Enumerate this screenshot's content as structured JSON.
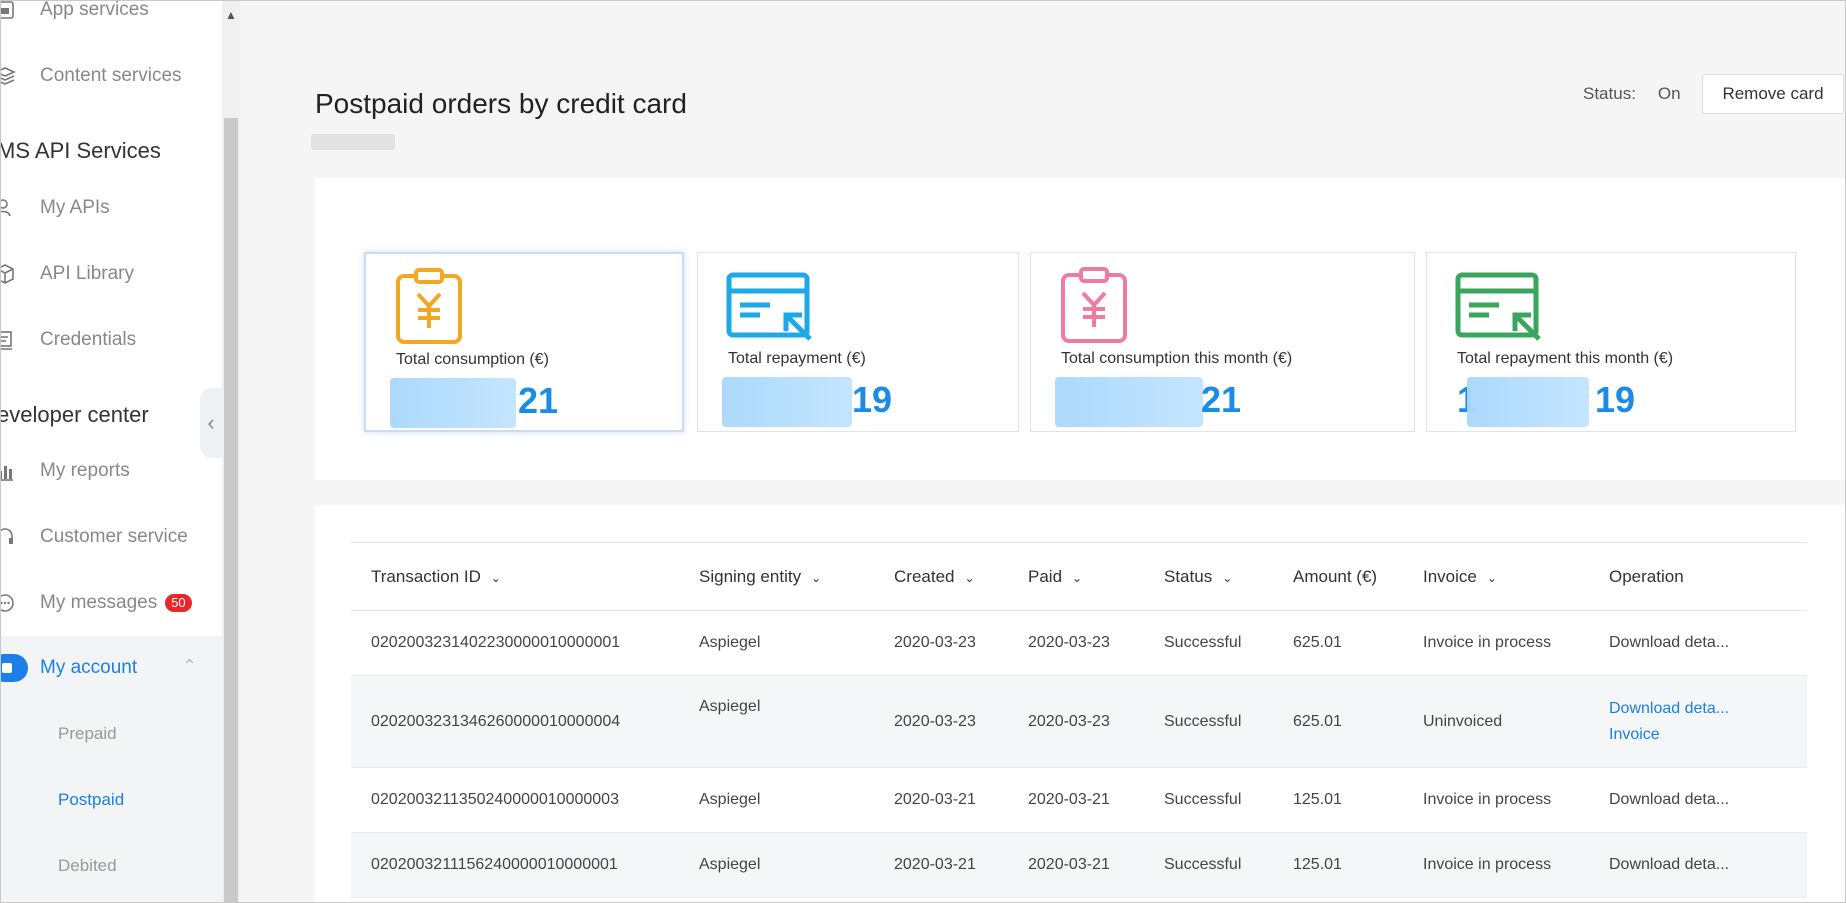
{
  "sidebar": {
    "items": [
      {
        "label": "App services",
        "icon": "app-icon"
      },
      {
        "label": "Content services",
        "icon": "layers-icon"
      }
    ],
    "section_api": "MS API Services",
    "api_items": [
      {
        "label": "My APIs",
        "icon": "user-api-icon"
      },
      {
        "label": "API Library",
        "icon": "cube-icon"
      },
      {
        "label": "Credentials",
        "icon": "credentials-icon"
      }
    ],
    "section_dev": "eveloper center",
    "dev_items": [
      {
        "label": "My reports",
        "icon": "bar-chart-icon"
      },
      {
        "label": "Customer service",
        "icon": "headset-icon"
      },
      {
        "label": "My messages",
        "icon": "chat-icon",
        "badge": "50"
      }
    ],
    "account": {
      "label": "My account",
      "icon": "wallet-icon"
    },
    "account_sub": [
      {
        "label": "Prepaid"
      },
      {
        "label": "Postpaid"
      },
      {
        "label": "Debited"
      }
    ]
  },
  "header": {
    "title": "Postpaid orders by credit card",
    "status_label": "Status:",
    "status_value": "On",
    "remove_button": "Remove card"
  },
  "cards": [
    {
      "label": "Total consumption (€)",
      "value_suffix": "21",
      "icon": "clipboard-yen-icon",
      "color": "#f5a623"
    },
    {
      "label": "Total repayment (€)",
      "value_suffix": "19",
      "icon": "card-return-icon",
      "color": "#1da9e6"
    },
    {
      "label": "Total consumption this month (€)",
      "value_suffix": "21",
      "icon": "clipboard-yen-icon",
      "color": "#f07aa0"
    },
    {
      "label": "Total repayment this month (€)",
      "value_prefix": "1",
      "value_suffix": "19",
      "icon": "card-return-icon",
      "color": "#3aa55c"
    }
  ],
  "table": {
    "headers": [
      "Transaction ID",
      "Signing entity",
      "Created",
      "Paid",
      "Status",
      "Amount (€)",
      "Invoice",
      "Operation"
    ],
    "rows": [
      {
        "id": "0202003231402230000010000001",
        "entity": "Aspiegel",
        "created": "2020-03-23",
        "paid": "2020-03-23",
        "status": "Successful",
        "amount": "625.01",
        "invoice": "Invoice in process",
        "op1": "Download deta...",
        "op2": ""
      },
      {
        "id": "0202003231346260000010000004",
        "entity": "Aspiegel",
        "created": "2020-03-23",
        "paid": "2020-03-23",
        "status": "Successful",
        "amount": "625.01",
        "invoice": "Uninvoiced",
        "op1": "Download deta...",
        "op2": "Invoice"
      },
      {
        "id": "0202003211350240000010000003",
        "entity": "Aspiegel",
        "created": "2020-03-21",
        "paid": "2020-03-21",
        "status": "Successful",
        "amount": "125.01",
        "invoice": "Invoice in process",
        "op1": "Download deta...",
        "op2": ""
      },
      {
        "id": "0202003211156240000010000001",
        "entity": "Aspiegel",
        "created": "2020-03-21",
        "paid": "2020-03-21",
        "status": "Successful",
        "amount": "125.01",
        "invoice": "Invoice in process",
        "op1": "Download deta...",
        "op2": ""
      }
    ]
  },
  "colors": {
    "accent": "#1a7fe8",
    "value": "#1a8ce8",
    "badge": "#e8272b"
  }
}
